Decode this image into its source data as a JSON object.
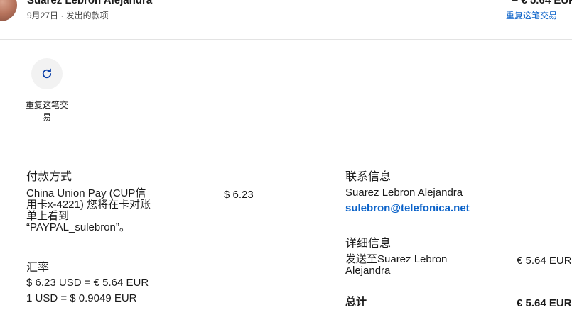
{
  "header": {
    "name": "Suarez Lebron Alejandra",
    "subline": "9月27日 · 发出的款项",
    "amount": "− € 5.64 EUR",
    "repeat_link": "重复这笔交易"
  },
  "actions": {
    "repeat_label": "重复这笔交易",
    "repeat_icon": "refresh-icon"
  },
  "payment": {
    "title": "付款方式",
    "description": "China Union Pay (CUP信用卡x-4221) 您将在卡对账单上看到 “PAYPAL_sulebron”。",
    "amount": "$ 6.23"
  },
  "exchange": {
    "title": "汇率",
    "line1": "$ 6.23 USD = € 5.64 EUR",
    "line2": "1 USD = $ 0.9049 EUR"
  },
  "contact": {
    "title": "联系信息",
    "name": "Suarez Lebron Alejandra",
    "email": "sulebron@telefonica.net"
  },
  "details": {
    "title": "详细信息",
    "description": "发送至Suarez Lebron Alejandra",
    "amount": "€ 5.64 EUR",
    "total_label": "总计",
    "total_amount": "€ 5.64 EUR"
  },
  "colors": {
    "link": "#0a62c9",
    "divider": "#e3e3e3",
    "icon_circle": "#f2f2f2"
  }
}
